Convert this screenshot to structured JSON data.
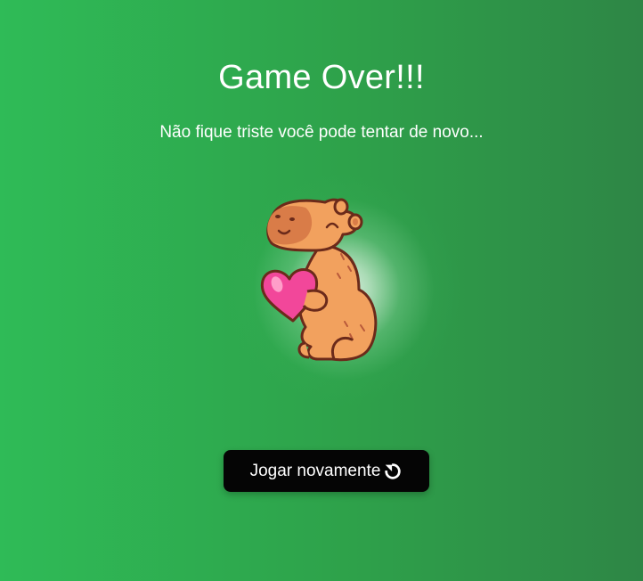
{
  "screen": {
    "title": "Game Over!!!",
    "subtitle": "Não fique triste você pode tentar de novo...",
    "play_again_label": "Jogar novamente",
    "play_again_icon": "refresh-icon",
    "mascot_icon": "capybara-heart-icon"
  },
  "colors": {
    "background_left": "#2fbb57",
    "background_right": "#2e8646",
    "button": "#050505",
    "heart": "#f2479a",
    "capybara": "#f2a15e"
  }
}
